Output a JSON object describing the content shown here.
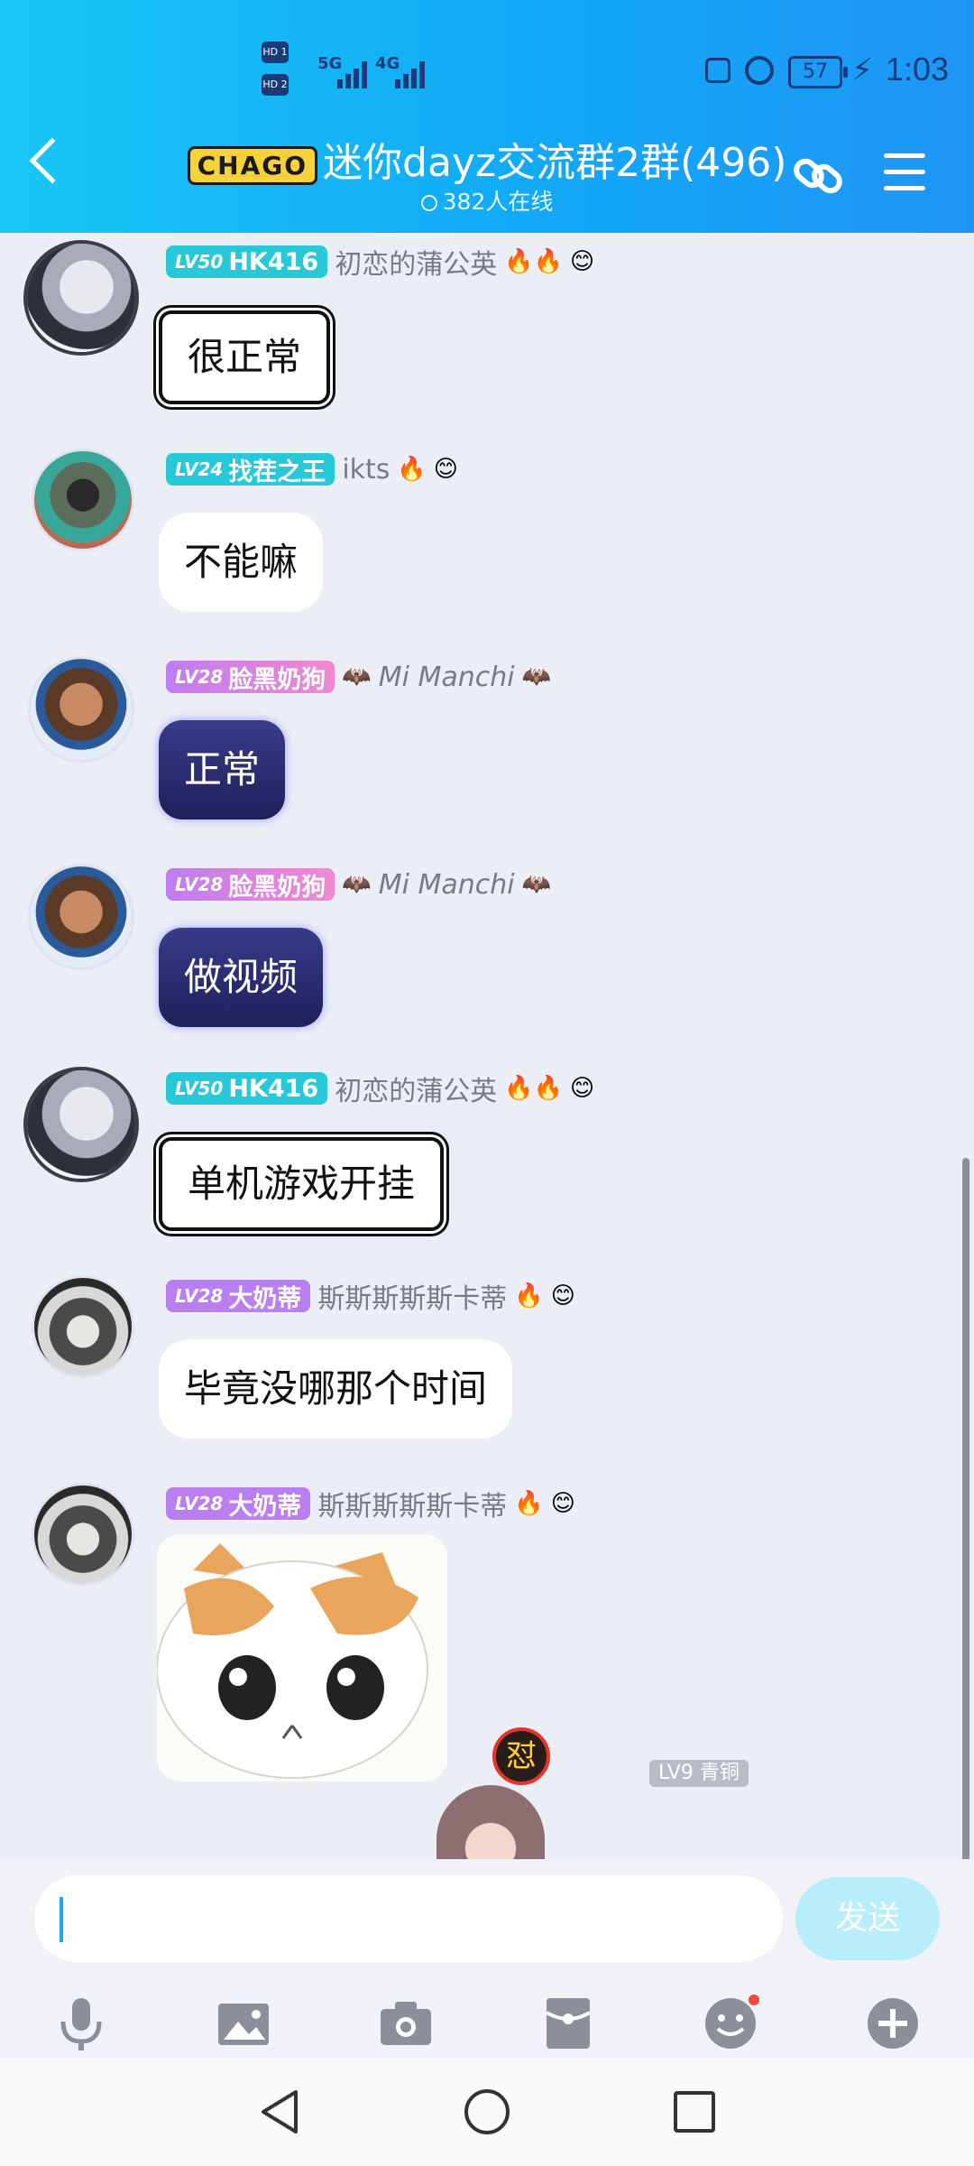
{
  "status_bar": {
    "sim1": "HD 1",
    "sim2": "HD 2",
    "network1": "5G",
    "network2": "4G",
    "battery": "57",
    "time": "1:03"
  },
  "header": {
    "logo_text": "CHAGO",
    "title": "迷你dayz交流群2群(496)",
    "online": "382人在线",
    "back_icon": "chevron-left-icon",
    "link_icon": "link-chain-icon",
    "menu_icon": "hamburger-menu-icon"
  },
  "messages": [
    {
      "level": "LV50",
      "title": "HK416",
      "nick": "初恋的蒲公英",
      "text": "很正常",
      "badge_color": "#27c8d8"
    },
    {
      "level": "LV24",
      "title": "找茬之王",
      "nick": "ikts",
      "text": "不能嘛",
      "badge_color": "#27c8d8"
    },
    {
      "level": "LV28",
      "title": "脸黑奶狗",
      "nick": "Mi Manchi",
      "text": "正常",
      "badge_color": "#e07ae8"
    },
    {
      "level": "LV28",
      "title": "脸黑奶狗",
      "nick": "Mi Manchi",
      "text": "做视频",
      "badge_color": "#e07ae8"
    },
    {
      "level": "LV50",
      "title": "HK416",
      "nick": "初恋的蒲公英",
      "text": "单机游戏开挂",
      "badge_color": "#27c8d8"
    },
    {
      "level": "LV28",
      "title": "大奶蒂",
      "nick": "斯斯斯斯斯卡蒂",
      "text": "毕竟没哪那个时间",
      "badge_color": "#bb7ef0"
    },
    {
      "level": "LV28",
      "title": "大奶蒂",
      "nick": "斯斯斯斯斯卡蒂",
      "text": "",
      "badge_color": "#bb7ef0"
    }
  ],
  "partial_badge": "LV9 青铜",
  "input": {
    "placeholder": "",
    "send_label": "发送"
  },
  "toolbar": [
    "microphone-icon",
    "image-icon",
    "camera-icon",
    "red-packet-icon",
    "emoji-icon",
    "plus-icon"
  ],
  "nav": [
    "back-triangle-icon",
    "home-circle-icon",
    "recents-square-icon"
  ]
}
